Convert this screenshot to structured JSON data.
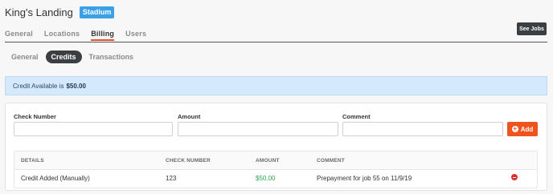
{
  "header": {
    "site_name": "King's Landing",
    "badge": "Stadium"
  },
  "top_tabs": [
    "General",
    "Locations",
    "Billing",
    "Users"
  ],
  "see_jobs_label": "See Jobs",
  "sub_tabs": [
    "General",
    "Credits",
    "Transactions"
  ],
  "alert": {
    "prefix": "Credit Available is",
    "amount": "$50.00"
  },
  "form": {
    "check_number_label": "Check Number",
    "amount_label": "Amount",
    "comment_label": "Comment",
    "add_label": "Add"
  },
  "table": {
    "headers": [
      "DETAILS",
      "CHECK NUMBER",
      "AMOUNT",
      "COMMENT"
    ],
    "rows": [
      {
        "details": "Credit Added (Manually)",
        "check_number": "123",
        "amount": "$50.00",
        "comment": "Prepayment for job 55 on 11/9/19"
      }
    ]
  },
  "colors": {
    "accent": "#e8502a",
    "info_bg": "#d4e9fb",
    "amount_green": "#2ea44f",
    "badge_blue": "#3aa0e8"
  }
}
